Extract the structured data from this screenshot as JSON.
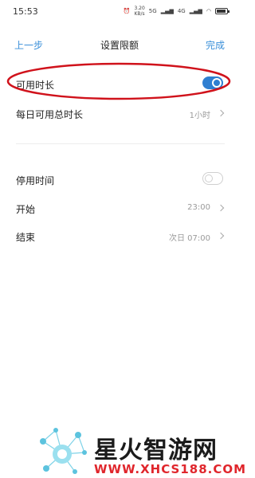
{
  "status_bar": {
    "time": "15:53",
    "speed_top": "3.20",
    "speed_bottom": "KB/s",
    "signal_1": "5G",
    "signal_2": "4G"
  },
  "nav": {
    "back": "上一步",
    "title": "设置限额",
    "done": "完成"
  },
  "rows": {
    "available_time": {
      "label": "可用时长",
      "toggle": "on"
    },
    "daily_total": {
      "label": "每日可用总时长",
      "value": "1小时"
    },
    "downtime": {
      "label": "停用时间",
      "toggle": "off"
    },
    "start": {
      "label": "开始",
      "value": "23:00"
    },
    "end": {
      "label": "结束",
      "value": "次日 07:00"
    }
  },
  "annotation": {
    "color": "#d0121b"
  },
  "watermark": {
    "title": "星火智游网",
    "url": "WWW.XHCS188.COM",
    "url_color": "#e0262c"
  },
  "colors": {
    "accent": "#2f7fd1",
    "link": "#3a8fd9"
  }
}
